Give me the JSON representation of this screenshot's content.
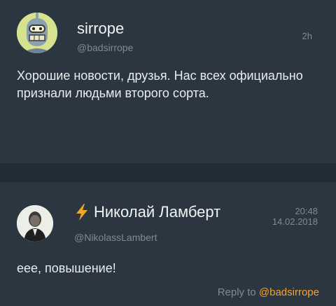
{
  "post1": {
    "author_name": "sirrope",
    "handle": "@badsirrope",
    "time": "2h",
    "text": "Хорошие новости, друзья. Нас всех официально признали людьми второго сорта.",
    "avatar_icon": "bender-avatar-icon"
  },
  "post2": {
    "author_name": "Николай Ламберт",
    "handle": "@NikolassLambert",
    "time": "20:48",
    "date": "14.02.2018",
    "text": "еее, повышение!",
    "reply_prefix": "Reply to",
    "reply_mention": "@badsirrope",
    "name_icon": "lightning-bolt-icon",
    "avatar_icon": "man-in-suit-avatar-icon"
  },
  "colors": {
    "background": "#243038",
    "card": "#2b3640",
    "muted_text": "#7e8b94",
    "accent": "#f3a52a",
    "bolt": "#f3a52a"
  }
}
